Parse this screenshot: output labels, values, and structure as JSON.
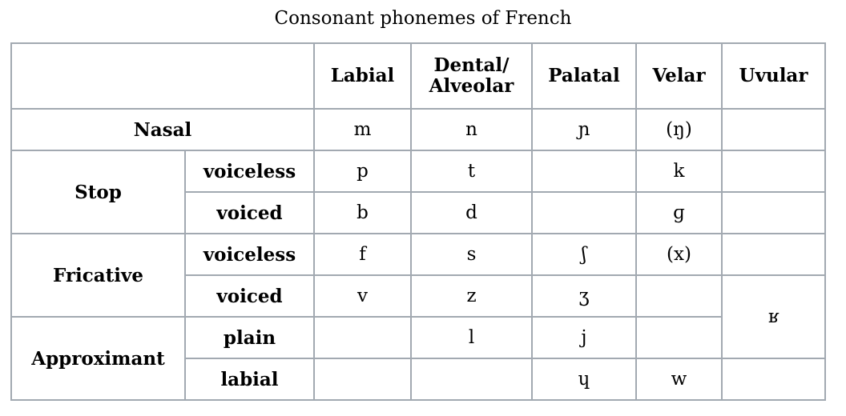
{
  "caption": "Consonant phonemes of French",
  "columns": [
    "Labial",
    "Dental/\nAlveolar",
    "Palatal",
    "Velar",
    "Uvular"
  ],
  "manners": {
    "nasal": "Nasal",
    "stop": "Stop",
    "fricative": "Fricative",
    "approximant": "Approximant"
  },
  "sub": {
    "voiceless": "voiceless",
    "voiced": "voiced",
    "plain": "plain",
    "labial": "labial"
  },
  "cells": {
    "nasal": [
      "m",
      "n",
      "ɲ",
      "(ŋ)",
      ""
    ],
    "stop_voiceless": [
      "p",
      "t",
      "",
      "k",
      ""
    ],
    "stop_voiced": [
      "b",
      "d",
      "",
      "ɡ",
      ""
    ],
    "fric_voiceless": [
      "f",
      "s",
      "ʃ",
      "(x)",
      ""
    ],
    "fric_voiced": [
      "v",
      "z",
      "ʒ",
      ""
    ],
    "uvular_merged": "ʁ",
    "approx_plain": [
      "",
      "l",
      "j",
      ""
    ],
    "approx_labial": [
      "",
      "",
      "ɥ",
      "w",
      ""
    ]
  }
}
